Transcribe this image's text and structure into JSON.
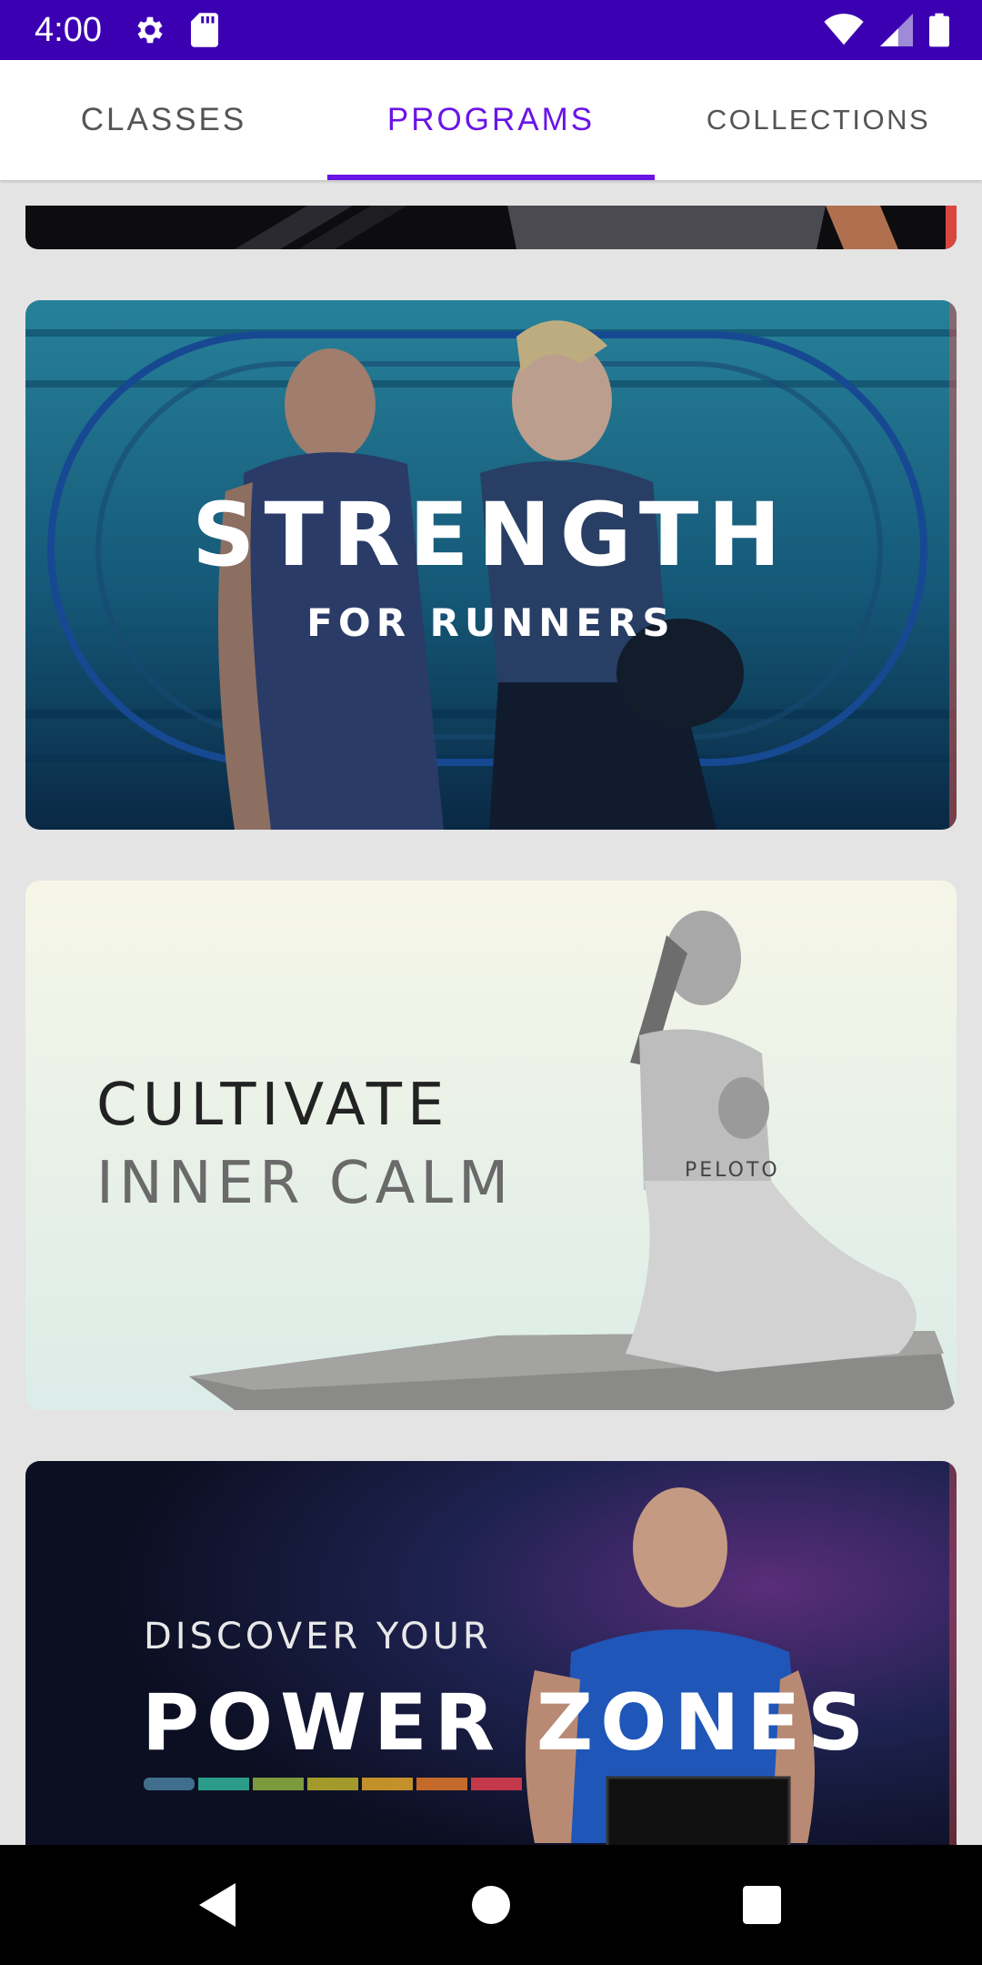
{
  "status_bar": {
    "time": "4:00",
    "icons": [
      "gear-icon",
      "sd-card-icon",
      "wifi-icon",
      "signal-icon",
      "battery-icon"
    ]
  },
  "tabs": [
    {
      "label": "CLASSES",
      "selected": false
    },
    {
      "label": "PROGRAMS",
      "selected": true
    },
    {
      "label": "COLLECTIONS",
      "selected": false
    }
  ],
  "programs": [
    {
      "title": "",
      "subtitle": ""
    },
    {
      "title": "STRENGTH",
      "subtitle": "FOR RUNNERS"
    },
    {
      "title": "CULTIVATE",
      "subtitle": "INNER CALM",
      "shirt_text": "PELOTO"
    },
    {
      "title": "DISCOVER YOUR",
      "subtitle": "POWER ZONES"
    }
  ],
  "colors": {
    "status_bar": "#3c00b3",
    "accent": "#6a14e6",
    "tab_text": "#555555",
    "background": "#e4e4e4"
  },
  "nav_bar": {
    "icons": [
      "back-icon",
      "home-icon",
      "recents-icon"
    ]
  }
}
